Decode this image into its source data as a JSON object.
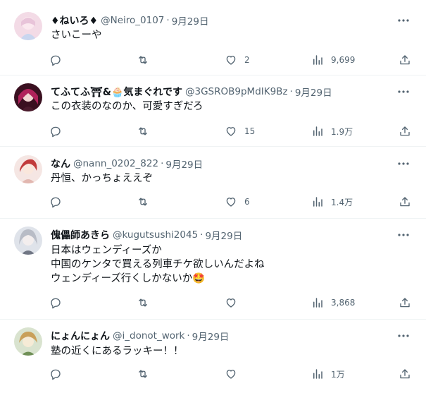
{
  "tweets": [
    {
      "name": "♦ねいろ♦",
      "handle": "@Neiro_0107",
      "date": "9月29日",
      "lines": [
        "さいこーや"
      ],
      "replies": "",
      "retweets": "",
      "likes": "2",
      "views": "9,699"
    },
    {
      "name": "てふてふ⛩&🧁気まぐれです",
      "handle": "@3GSROB9pMdIK9Bz",
      "date": "9月29日",
      "lines": [
        "この衣装のなのか、可愛すぎだろ"
      ],
      "replies": "",
      "retweets": "",
      "likes": "15",
      "views": "1.9万"
    },
    {
      "name": "なん",
      "handle": "@nann_0202_822",
      "date": "9月29日",
      "lines": [
        "丹恒、かっちょええぞ"
      ],
      "replies": "",
      "retweets": "",
      "likes": "6",
      "views": "1.4万"
    },
    {
      "name": "傀儡師あきら",
      "handle": "@kugutsushi2045",
      "date": "9月29日",
      "lines": [
        "日本はウェンディーズか",
        "中国のケンタで買える列車チケ欲しいんだよね",
        "ウェンディーズ行くしかないか🤩"
      ],
      "replies": "",
      "retweets": "",
      "likes": "",
      "views": "3,868"
    },
    {
      "name": "にょんにょん",
      "handle": "@i_donot_work",
      "date": "9月29日",
      "lines": [
        "塾の近くにあるラッキー！！"
      ],
      "replies": "",
      "retweets": "",
      "likes": "",
      "views": "1万"
    }
  ],
  "icons": {
    "reply": "reply-icon",
    "retweet": "retweet-icon",
    "like": "heart-icon",
    "views": "views-chart-icon",
    "share": "share-icon",
    "more": "more-dots-icon"
  },
  "colors": {
    "text": "#0f1419",
    "muted": "#536471",
    "divider": "#eff3f4"
  }
}
